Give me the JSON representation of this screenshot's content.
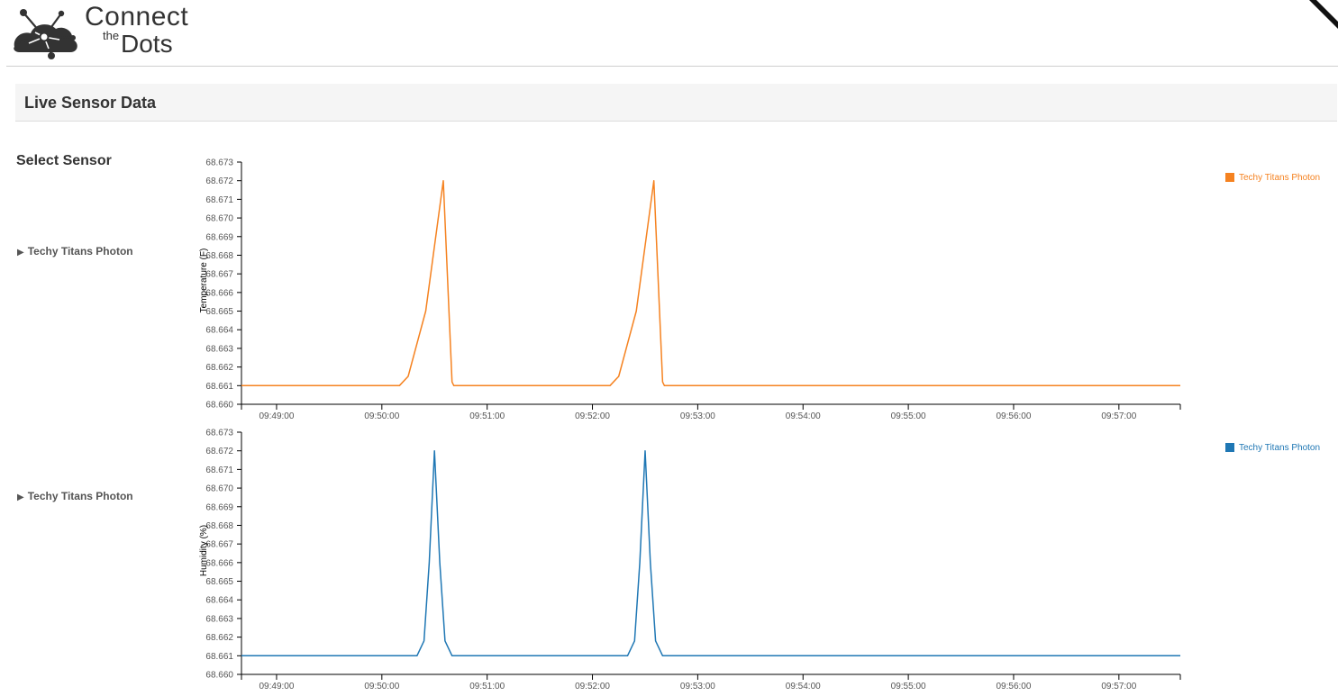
{
  "brand": {
    "connect": "Connect",
    "the": "the",
    "dots": "Dots"
  },
  "panel": {
    "title": "Live Sensor Data"
  },
  "sidebar": {
    "title": "Select Sensor",
    "items": [
      {
        "label": "Techy Titans Photon",
        "icon": "triangle-right-icon"
      },
      {
        "label": "Techy Titans Photon",
        "icon": "triangle-right-icon"
      }
    ]
  },
  "charts": [
    {
      "ylabel": "Temperature (F)",
      "legend": "Techy Titans Photon",
      "color": "#f58220"
    },
    {
      "ylabel": "Humidity (%)",
      "legend": "Techy Titans Photon",
      "color": "#1f77b4"
    }
  ],
  "chart_data": [
    {
      "type": "line",
      "title": "",
      "xlabel": "",
      "ylabel": "Temperature (F)",
      "ylim": [
        68.66,
        68.673
      ],
      "xlim": [
        "09:48:40",
        "09:57:35"
      ],
      "yticks": [
        "68.660",
        "68.661",
        "68.662",
        "68.663",
        "68.664",
        "68.665",
        "68.666",
        "68.667",
        "68.668",
        "68.669",
        "68.670",
        "68.671",
        "68.672",
        "68.673"
      ],
      "xticks": [
        "09:49:00",
        "09:50:00",
        "09:51:00",
        "09:52:00",
        "09:53:00",
        "09:54:00",
        "09:55:00",
        "09:56:00",
        "09:57:00"
      ],
      "series": [
        {
          "name": "Techy Titans Photon",
          "color": "#f58220",
          "points": [
            [
              "09:48:40",
              68.661
            ],
            [
              "09:50:10",
              68.661
            ],
            [
              "09:50:15",
              68.6615
            ],
            [
              "09:50:25",
              68.665
            ],
            [
              "09:50:35",
              68.672
            ],
            [
              "09:50:40",
              68.6612
            ],
            [
              "09:50:41",
              68.661
            ],
            [
              "09:52:10",
              68.661
            ],
            [
              "09:52:15",
              68.6615
            ],
            [
              "09:52:25",
              68.665
            ],
            [
              "09:52:35",
              68.672
            ],
            [
              "09:52:40",
              68.6612
            ],
            [
              "09:52:41",
              68.661
            ],
            [
              "09:57:35",
              68.661
            ]
          ]
        }
      ],
      "grid": false,
      "legend_position": "top-right"
    },
    {
      "type": "line",
      "title": "",
      "xlabel": "",
      "ylabel": "Humidity (%)",
      "ylim": [
        68.66,
        68.673
      ],
      "xlim": [
        "09:48:40",
        "09:57:35"
      ],
      "yticks": [
        "68.660",
        "68.661",
        "68.662",
        "68.663",
        "68.664",
        "68.665",
        "68.666",
        "68.667",
        "68.668",
        "68.669",
        "68.670",
        "68.671",
        "68.672",
        "68.673"
      ],
      "xticks": [
        "09:49:00",
        "09:50:00",
        "09:51:00",
        "09:52:00",
        "09:53:00",
        "09:54:00",
        "09:55:00",
        "09:56:00",
        "09:57:00"
      ],
      "series": [
        {
          "name": "Techy Titans Photon",
          "color": "#1f77b4",
          "points": [
            [
              "09:48:40",
              68.661
            ],
            [
              "09:50:20",
              68.661
            ],
            [
              "09:50:24",
              68.6618
            ],
            [
              "09:50:27",
              68.666
            ],
            [
              "09:50:30",
              68.672
            ],
            [
              "09:50:33",
              68.666
            ],
            [
              "09:50:36",
              68.6618
            ],
            [
              "09:50:40",
              68.661
            ],
            [
              "09:52:20",
              68.661
            ],
            [
              "09:52:24",
              68.6618
            ],
            [
              "09:52:27",
              68.666
            ],
            [
              "09:52:30",
              68.672
            ],
            [
              "09:52:33",
              68.666
            ],
            [
              "09:52:36",
              68.6618
            ],
            [
              "09:52:40",
              68.661
            ],
            [
              "09:57:35",
              68.661
            ]
          ]
        }
      ],
      "grid": false,
      "legend_position": "top-right"
    }
  ]
}
